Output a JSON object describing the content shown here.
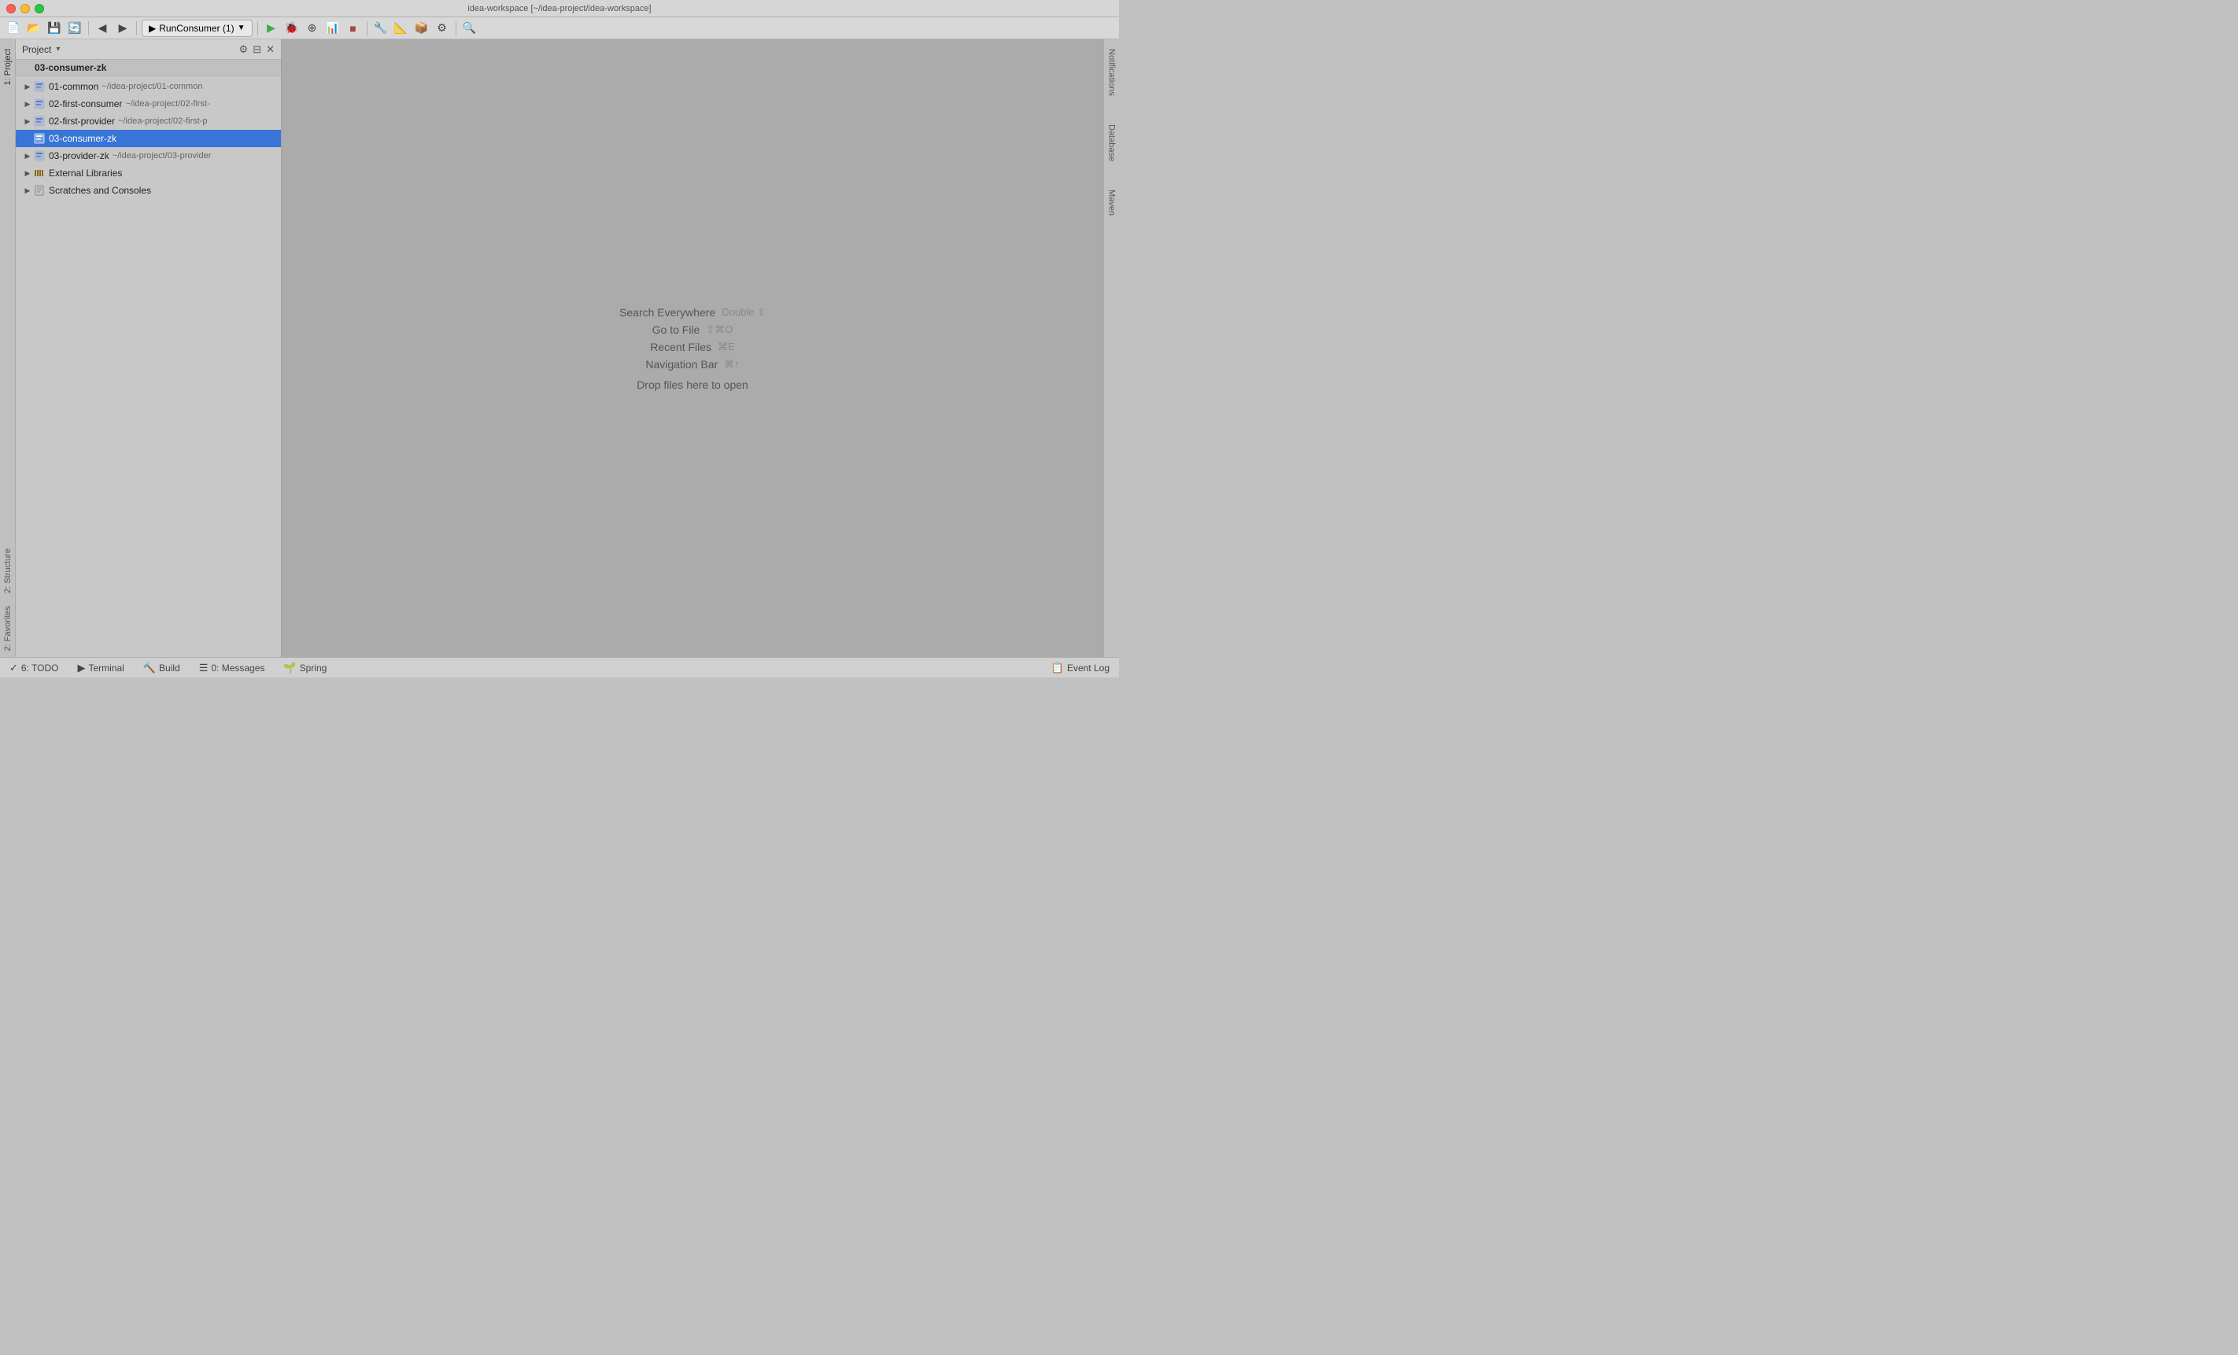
{
  "window": {
    "title": "idea-workspace [~/idea-project/idea-workspace]"
  },
  "titlebar": {
    "buttons": [
      "close",
      "minimize",
      "maximize"
    ]
  },
  "toolbar": {
    "run_config_label": "RunConsumer (1)",
    "buttons": [
      "back",
      "forward",
      "bookmark",
      "build",
      "run",
      "debug",
      "coverage",
      "profile",
      "stop",
      "tools1",
      "tools2",
      "tools3",
      "tools4",
      "search"
    ]
  },
  "project_header": {
    "title": "Project",
    "arrow": "▾"
  },
  "project_header_title_full": "03-consumer-zk",
  "tree_items": [
    {
      "id": "01-common",
      "label": "01-common",
      "path": "~/idea-project/01-common",
      "indent": 0,
      "has_arrow": true,
      "arrow_open": false,
      "icon": "module",
      "selected": false
    },
    {
      "id": "02-first-consumer",
      "label": "02-first-consumer",
      "path": "~/idea-project/02-first-",
      "indent": 0,
      "has_arrow": true,
      "arrow_open": false,
      "icon": "module",
      "selected": false
    },
    {
      "id": "02-first-provider",
      "label": "02-first-provider",
      "path": "~/idea-project/02-first-p",
      "indent": 0,
      "has_arrow": true,
      "arrow_open": false,
      "icon": "module",
      "selected": false
    },
    {
      "id": "03-consumer-zk",
      "label": "03-consumer-zk",
      "path": "",
      "indent": 0,
      "has_arrow": false,
      "arrow_open": false,
      "icon": "module",
      "selected": true
    },
    {
      "id": "03-provider-zk",
      "label": "03-provider-zk",
      "path": "~/idea-project/03-provider",
      "indent": 0,
      "has_arrow": true,
      "arrow_open": false,
      "icon": "module",
      "selected": false
    },
    {
      "id": "external-libraries",
      "label": "External Libraries",
      "path": "",
      "indent": 0,
      "has_arrow": true,
      "arrow_open": false,
      "icon": "library",
      "selected": false
    },
    {
      "id": "scratches-consoles",
      "label": "Scratches and Consoles",
      "path": "",
      "indent": 0,
      "has_arrow": true,
      "arrow_open": false,
      "icon": "scratch",
      "selected": false
    }
  ],
  "editor": {
    "search_everywhere_label": "Search Everywhere",
    "search_everywhere_shortcut": "Double ⇧",
    "go_to_file_label": "Go to File",
    "go_to_file_shortcut": "⇧⌘O",
    "recent_files_label": "Recent Files",
    "recent_files_shortcut": "⌘E",
    "navigation_bar_label": "Navigation Bar",
    "navigation_bar_shortcut": "⌘↑",
    "drop_files_label": "Drop files here to open"
  },
  "status_bar": {
    "items": [
      {
        "icon": "✓",
        "label": "6: TODO"
      },
      {
        "icon": "▶",
        "label": "Terminal"
      },
      {
        "icon": "🔨",
        "label": "Build"
      },
      {
        "icon": "☰",
        "label": "0: Messages"
      },
      {
        "icon": "🌱",
        "label": "Spring"
      }
    ],
    "right_item": {
      "icon": "📋",
      "label": "Event Log"
    }
  },
  "side_panels": {
    "left_top": "1: Project",
    "left_bottom_structure": "2: Structure",
    "left_bottom_fav": "2: Favorites",
    "right_top": "Notifications",
    "right_database": "Database",
    "right_maven": "Maven"
  }
}
